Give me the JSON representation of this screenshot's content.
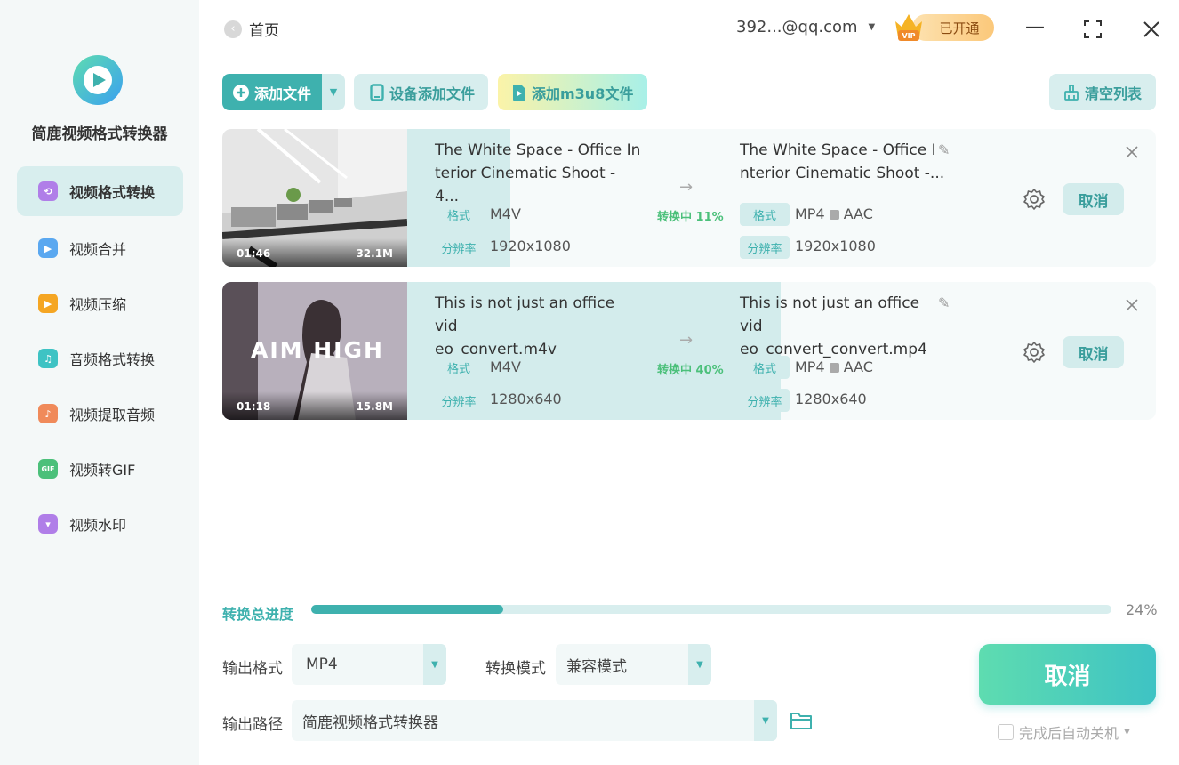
{
  "app": {
    "title": "简鹿视频格式转换器"
  },
  "sidebar": {
    "items": [
      {
        "label": "视频格式转换",
        "color": "#b07ee8",
        "active": true
      },
      {
        "label": "视频合并",
        "color": "#5aa8f0"
      },
      {
        "label": "视频压缩",
        "color": "#f5a623"
      },
      {
        "label": "音频格式转换",
        "color": "#3ec3c4"
      },
      {
        "label": "视频提取音频",
        "color": "#f08a5a"
      },
      {
        "label": "视频转GIF",
        "color": "#4bc07a"
      },
      {
        "label": "视频水印",
        "color": "#b07ee8"
      }
    ]
  },
  "topbar": {
    "home": "首页",
    "account": "392...@qq.com",
    "vip": "已开通",
    "vip_badge": "VIP"
  },
  "toolbar": {
    "add_file": "添加文件",
    "device_add": "设备添加文件",
    "add_m3u8": "添加m3u8文件",
    "clear_list": "清空列表"
  },
  "files": [
    {
      "duration": "01:46",
      "size": "32.1M",
      "src_name": "The White Space - Office In\nterior Cinematic Shoot - 4...",
      "dst_name": "The White Space - Office I\nnterior Cinematic Shoot -...",
      "format_tag": "格式",
      "res_tag": "分辨率",
      "src_format": "M4V",
      "src_res": "1920x1080",
      "dst_format": "MP4",
      "dst_audio": "AAC",
      "dst_res": "1920x1080",
      "status": "转换中 11%",
      "progress": 0.11,
      "cancel": "取消"
    },
    {
      "duration": "01:18",
      "size": "15.8M",
      "thumb_text": "AIM HIGH",
      "src_name": "This is not just an office vid\neo_convert.m4v",
      "dst_name": "This is not just an office vid\neo_convert_convert.mp4",
      "format_tag": "格式",
      "res_tag": "分辨率",
      "src_format": "M4V",
      "src_res": "1280x640",
      "dst_format": "MP4",
      "dst_audio": "AAC",
      "dst_res": "1280x640",
      "status": "转换中 40%",
      "progress": 0.4,
      "cancel": "取消"
    }
  ],
  "total": {
    "label": "转换总进度",
    "percent_text": "24%",
    "progress": 0.24
  },
  "output": {
    "format_label": "输出格式",
    "format_value": "MP4",
    "mode_label": "转换模式",
    "mode_value": "兼容模式",
    "path_label": "输出路径",
    "path_value": "简鹿视频格式转换器"
  },
  "actions": {
    "cancel": "取消",
    "shutdown": "完成后自动关机"
  }
}
